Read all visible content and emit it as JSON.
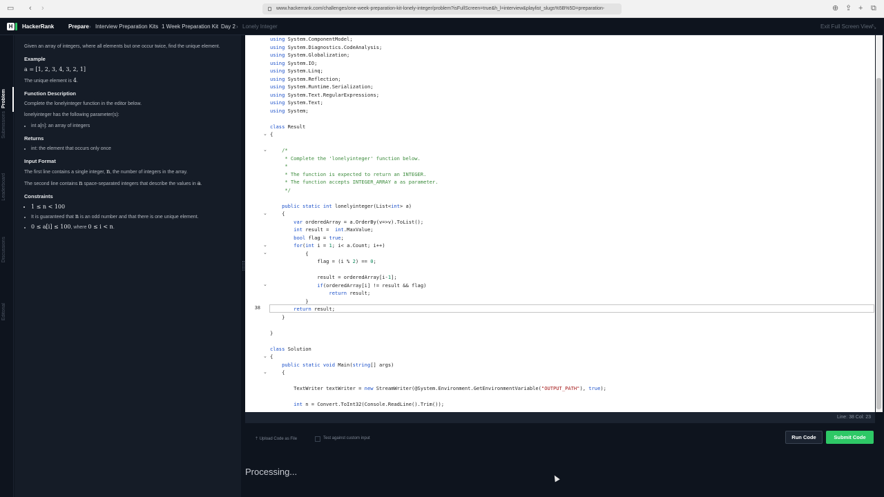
{
  "browser": {
    "url": "www.hackerrank.com/challenges/one-week-preparation-kit-lonely-integer/problem?isFullScreen=true&h_l=interview&playlist_slugs%5B%5D=preparation-"
  },
  "nav": {
    "brand": "HackerRank",
    "crumbs": [
      "Prepare",
      "Interview Preparation Kits",
      "1 Week Preparation Kit",
      "Day 2",
      "Lonely Integer"
    ],
    "exit": "Exit Full Screen View"
  },
  "rail": {
    "tabs": [
      "Problem",
      "Submissions",
      "Leaderboard",
      "Discussions",
      "Editorial"
    ]
  },
  "problem": {
    "intro": "Given an array of integers, where all elements but one occur twice, find the unique element.",
    "example_heading": "Example",
    "example_array": "a = [1, 2, 3, 4, 3, 2, 1]",
    "example_result_prefix": "The unique element is ",
    "example_result_value": "4",
    "fd_heading": "Function Description",
    "fd_text": "Complete the lonelyinteger function in the editor below.",
    "fd_params": "lonelyinteger has the following parameter(s):",
    "fd_param1": "int a[n]: an array of integers",
    "returns_heading": "Returns",
    "returns_item": "int: the element that occurs only once",
    "input_heading": "Input Format",
    "input_line1_a": "The first line contains a single integer, ",
    "input_line1_var": "n",
    "input_line1_b": ", the number of integers in the array.",
    "input_line2_a": "The second line contains ",
    "input_line2_var": "n",
    "input_line2_b": " space-separated integers that describe the values in ",
    "input_line2_var2": "a",
    "input_line2_c": ".",
    "constraints_heading": "Constraints",
    "c1": "1 ≤ n < 100",
    "c2_a": "It is guaranteed that ",
    "c2_var": "n",
    "c2_b": " is an odd number and that there is one unique element.",
    "c3_math": "0 ≤ a[i] ≤ 100",
    "c3_mid": ", where ",
    "c3_math2": "0 ≤ i < n",
    "c3_end": "."
  },
  "editor": {
    "current_line_number": "38",
    "status": "Line: 38 Col: 23"
  },
  "actions": {
    "upload": "Upload Code as File",
    "custom_input": "Test against custom input",
    "run": "Run Code",
    "submit": "Submit Code"
  },
  "processing": "Processing...",
  "colors": {
    "accent_green": "#2ec866",
    "bg_dark": "#0e141e",
    "panel": "#151c27"
  }
}
